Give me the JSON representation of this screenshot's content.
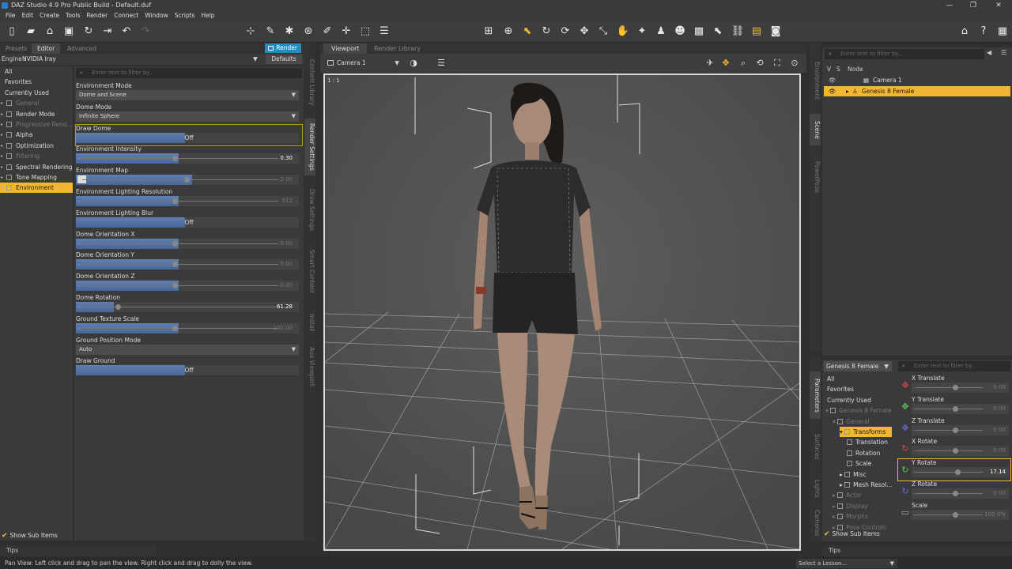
{
  "window": {
    "title": "DAZ Studio 4.9 Pro Public Build - Default.duf",
    "min": "—",
    "max": "❐",
    "close": "✕"
  },
  "menu": [
    "File",
    "Edit",
    "Create",
    "Tools",
    "Render",
    "Connect",
    "Window",
    "Scripts",
    "Help"
  ],
  "left_panel": {
    "tabs": [
      "Presets",
      "Editor",
      "Advanced"
    ],
    "render_button": "Render",
    "engine_label": "Engine :",
    "engine_value": "NVIDIA Iray",
    "defaults_button": "Defaults",
    "filter_placeholder": "Enter text to filter by...",
    "categories": [
      {
        "label": "All",
        "type": "plain"
      },
      {
        "label": "Favorites",
        "type": "plain"
      },
      {
        "label": "Currently Used",
        "type": "plain"
      },
      {
        "label": "General",
        "type": "dim"
      },
      {
        "label": "Render Mode",
        "type": "normal"
      },
      {
        "label": "Progressive Rend...",
        "type": "dim"
      },
      {
        "label": "Alpha",
        "type": "normal"
      },
      {
        "label": "Optimization",
        "type": "normal"
      },
      {
        "label": "Filtering",
        "type": "dim"
      },
      {
        "label": "Spectral Rendering",
        "type": "normal"
      },
      {
        "label": "Tone Mapping",
        "type": "normal"
      },
      {
        "label": "Environment",
        "type": "selected"
      }
    ],
    "show_sub_items": "Show Sub Items",
    "properties": [
      {
        "label": "Environment Mode",
        "kind": "dropdown",
        "value": "Dome and Scene"
      },
      {
        "label": "Dome Mode",
        "kind": "dropdown",
        "value": "Infinite Sphere"
      },
      {
        "label": "Draw Dome",
        "kind": "toggle",
        "value": "Off"
      },
      {
        "label": "Environment Intensity",
        "kind": "slider",
        "value": "0.30",
        "pos": 0.46,
        "active": true
      },
      {
        "label": "Environment Map",
        "kind": "slider",
        "value": "2.00",
        "pos": 0.52,
        "active": false,
        "map": true
      },
      {
        "label": "Environment Lighting Resolution",
        "kind": "slider",
        "value": "512",
        "pos": 0.46,
        "active": false
      },
      {
        "label": "Environment Lighting Blur",
        "kind": "toggle",
        "value": "Off"
      },
      {
        "label": "Dome Orientation X",
        "kind": "slider",
        "value": "0.00",
        "pos": 0.46,
        "active": false
      },
      {
        "label": "Dome Orientation Y",
        "kind": "slider",
        "value": "0.00",
        "pos": 0.46,
        "active": false
      },
      {
        "label": "Dome Orientation Z",
        "kind": "slider",
        "value": "0.00",
        "pos": 0.46,
        "active": false
      },
      {
        "label": "Dome Rotation",
        "kind": "slider",
        "value": "61.28",
        "pos": 0.17,
        "active": true
      },
      {
        "label": "Ground Texture Scale",
        "kind": "slider",
        "value": "100.00",
        "pos": 0.46,
        "active": false
      },
      {
        "label": "Ground Position Mode",
        "kind": "dropdown",
        "value": "Auto"
      },
      {
        "label": "Draw Ground",
        "kind": "toggle",
        "value": "Off"
      }
    ],
    "vertical_tabs": [
      "Content Library",
      "Render Settings",
      "Draw Settings",
      "Smart Content",
      "Install",
      "Aux Viewport"
    ],
    "tips": "Tips"
  },
  "viewport": {
    "tabs": [
      "Viewport",
      "Render Library"
    ],
    "camera": "Camera 1",
    "aspect_label": "1 : 1"
  },
  "scene_pane": {
    "filter_placeholder": "Enter text to filter by...",
    "header_col_v": "V",
    "header_col_s": "S",
    "header_node": "Node",
    "nodes": [
      {
        "label": "Camera 1",
        "selected": false
      },
      {
        "label": "Genesis 8 Female",
        "selected": true
      }
    ],
    "vertical_tabs": [
      "Environment",
      "Scene",
      "PowerPose"
    ]
  },
  "param_pane": {
    "figure": "Genesis 8 Female",
    "filter_placeholder": "Enter text to filter by...",
    "tree": [
      {
        "label": "All",
        "indent": 0,
        "type": "plain"
      },
      {
        "label": "Favorites",
        "indent": 0,
        "type": "plain"
      },
      {
        "label": "Currently Used",
        "indent": 0,
        "type": "plain"
      },
      {
        "label": "Genesis 8 Female",
        "indent": 0,
        "type": "dim"
      },
      {
        "label": "General",
        "indent": 1,
        "type": "dim"
      },
      {
        "label": "Transforms",
        "indent": 2,
        "type": "selected"
      },
      {
        "label": "Translation",
        "indent": 3,
        "type": "normal"
      },
      {
        "label": "Rotation",
        "indent": 3,
        "type": "normal"
      },
      {
        "label": "Scale",
        "indent": 3,
        "type": "normal"
      },
      {
        "label": "Misc",
        "indent": 2,
        "type": "normal"
      },
      {
        "label": "Mesh Resol...",
        "indent": 2,
        "type": "normal"
      },
      {
        "label": "Actor",
        "indent": 1,
        "type": "dim"
      },
      {
        "label": "Display",
        "indent": 1,
        "type": "dim"
      },
      {
        "label": "Morphs",
        "indent": 1,
        "type": "dim"
      },
      {
        "label": "Pose Controls",
        "indent": 1,
        "type": "dim"
      }
    ],
    "sliders": [
      {
        "label": "X Translate",
        "value": "0.00",
        "color": "#d44",
        "pos": 0.55,
        "active": false
      },
      {
        "label": "Y Translate",
        "value": "0.00",
        "color": "#5c5",
        "pos": 0.55,
        "active": false
      },
      {
        "label": "Z Translate",
        "value": "0.00",
        "color": "#66d",
        "pos": 0.55,
        "active": false
      },
      {
        "label": "X Rotate",
        "value": "0.00",
        "color": "#d44",
        "pos": 0.55,
        "active": false
      },
      {
        "label": "Y Rotate",
        "value": "17.14",
        "color": "#5c5",
        "pos": 0.58,
        "active": true
      },
      {
        "label": "Z Rotate",
        "value": "0.00",
        "color": "#66d",
        "pos": 0.55,
        "active": false
      },
      {
        "label": "Scale",
        "value": "100.0%",
        "color": "#aaa",
        "pos": 0.55,
        "active": false
      }
    ],
    "show_sub_items": "Show Sub Items",
    "vertical_tabs": [
      "Parameters",
      "Surfaces",
      "Lights",
      "Cameras"
    ],
    "tips": "Tips"
  },
  "statusbar": {
    "message": "Pan View: Left click and drag to pan the view. Right click and drag to dolly the view.",
    "lesson": "Select a Lesson..."
  }
}
